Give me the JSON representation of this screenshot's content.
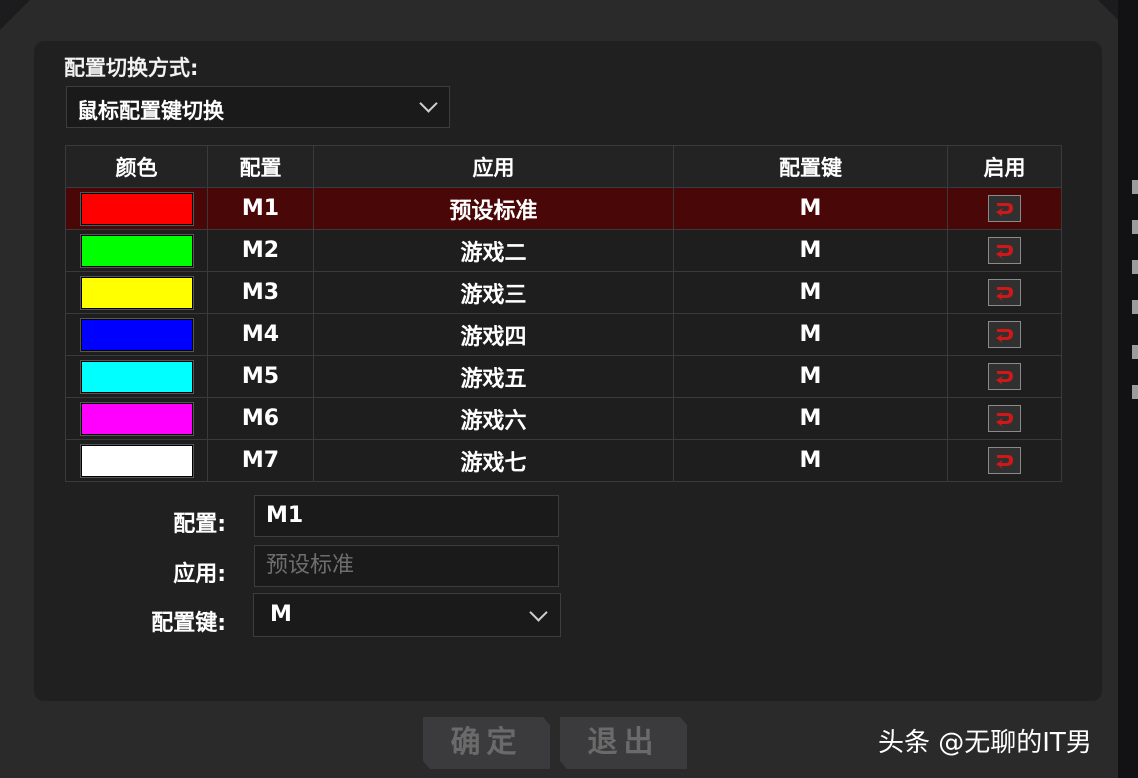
{
  "dialog": {
    "mode_label": "配置切换方式:",
    "mode_value": "鼠标配置键切换"
  },
  "table": {
    "headers": [
      "颜色",
      "配置",
      "应用",
      "配置键",
      "启用"
    ],
    "rows": [
      {
        "color": "#ff0000",
        "profile": "M1",
        "app": "预设标准",
        "key": "M",
        "selected": true
      },
      {
        "color": "#00ff00",
        "profile": "M2",
        "app": "游戏二",
        "key": "M",
        "selected": false
      },
      {
        "color": "#ffff00",
        "profile": "M3",
        "app": "游戏三",
        "key": "M",
        "selected": false
      },
      {
        "color": "#0000ff",
        "profile": "M4",
        "app": "游戏四",
        "key": "M",
        "selected": false
      },
      {
        "color": "#00ffff",
        "profile": "M5",
        "app": "游戏五",
        "key": "M",
        "selected": false
      },
      {
        "color": "#ff00ff",
        "profile": "M6",
        "app": "游戏六",
        "key": "M",
        "selected": false
      },
      {
        "color": "#ffffff",
        "profile": "M7",
        "app": "游戏七",
        "key": "M",
        "selected": false
      }
    ],
    "enable_icon": "red-arrow-icon"
  },
  "form": {
    "profile_label": "配置:",
    "profile_value": "M1",
    "app_label": "应用:",
    "app_placeholder": "预设标准",
    "key_label": "配置键:",
    "key_value": "M"
  },
  "buttons": {
    "confirm": "确定",
    "exit": "退出"
  },
  "watermark": "头条 @无聊的IT男",
  "colors": {
    "selected_row": "#4a0707",
    "icon_red": "#d01818"
  }
}
